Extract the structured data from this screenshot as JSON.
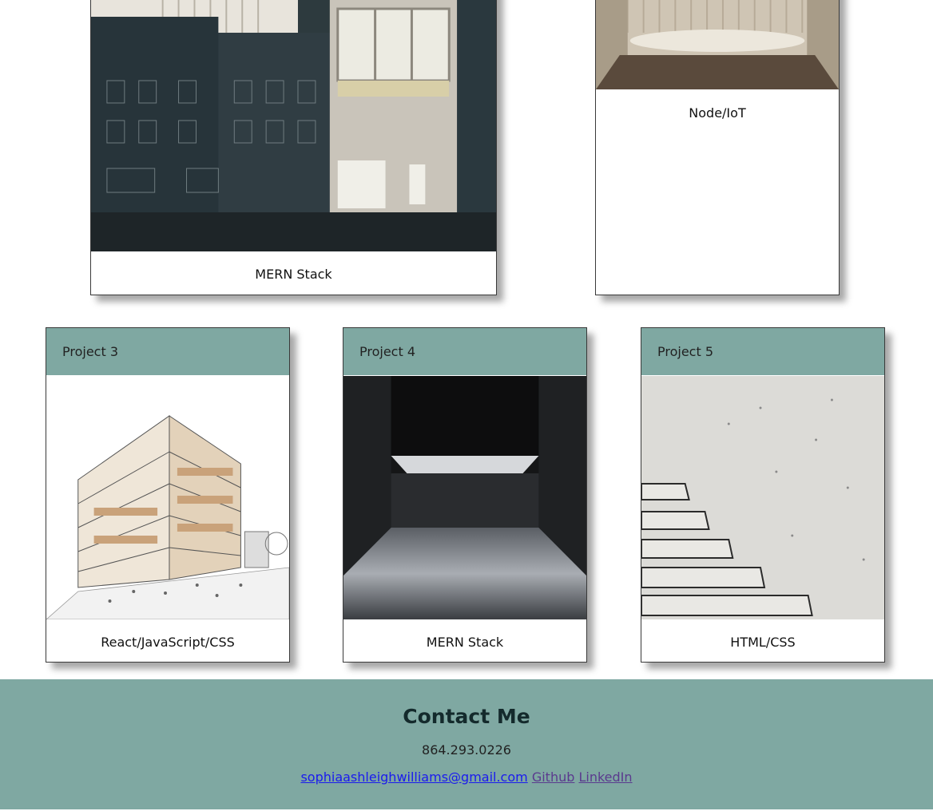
{
  "projects_top": [
    {
      "caption": "MERN Stack",
      "image": "architecture-building-facade"
    },
    {
      "caption": "Node/IoT",
      "image": "interior-room"
    }
  ],
  "projects": [
    {
      "title": "Project 3",
      "caption": "React/JavaScript/CSS",
      "image": "building-sketch"
    },
    {
      "title": "Project 4",
      "caption": "MERN Stack",
      "image": "dark-concrete-room"
    },
    {
      "title": "Project 5",
      "caption": "HTML/CSS",
      "image": "concrete-stairs"
    }
  ],
  "contact": {
    "title": "Contact Me",
    "phone": "864.293.0226",
    "email": "sophiaashleighwilliams@gmail.com",
    "github": "Github",
    "linkedin": "LinkedIn"
  },
  "colors": {
    "accent": "#7fa8a2",
    "link": "#1a1aee",
    "visited_link": "#5a3a8e"
  }
}
